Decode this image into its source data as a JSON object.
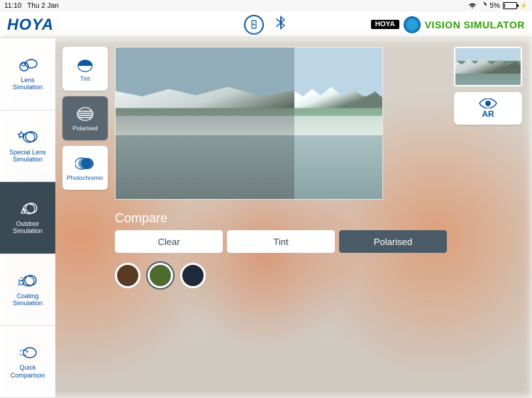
{
  "statusbar": {
    "time": "11:10",
    "date": "Thu 2 Jan",
    "battery_pct": "5%"
  },
  "header": {
    "logo": "HOYA",
    "brand_pill": "HOYA",
    "title": "VISION SIMULATOR"
  },
  "sidebar": {
    "items": [
      {
        "label": "Lens\nSimulation"
      },
      {
        "label": "Special Lens\nSimulation"
      },
      {
        "label": "Outdoor\nSimulation"
      },
      {
        "label": "Coating\nSimulation"
      },
      {
        "label": "Quick\nComparison"
      }
    ],
    "active_index": 2
  },
  "lens_options": {
    "items": [
      {
        "label": "Tint"
      },
      {
        "label": "Polarised"
      },
      {
        "label": "Photochromic"
      }
    ],
    "active_index": 1
  },
  "compare": {
    "title": "Compare",
    "buttons": [
      {
        "label": "Clear"
      },
      {
        "label": "Tint"
      },
      {
        "label": "Polarised"
      }
    ],
    "active_index": 2
  },
  "colors": {
    "swatches": [
      "#5a3a22",
      "#4f6a2f",
      "#1e2a3a"
    ],
    "selected_index": 1
  },
  "right": {
    "ar_label": "AR"
  }
}
